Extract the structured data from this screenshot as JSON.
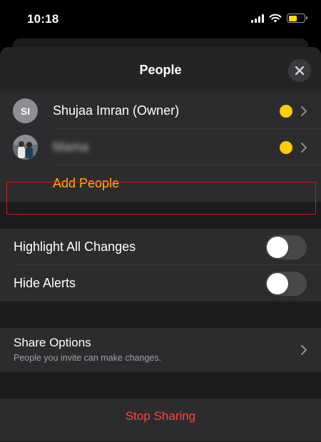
{
  "status": {
    "time": "10:18"
  },
  "sheet": {
    "title": "People"
  },
  "people": [
    {
      "initials": "SI",
      "name": "Shujaa Imran (Owner)"
    },
    {
      "initials": "",
      "name": "Mama"
    }
  ],
  "add_people_label": "Add People",
  "toggles": {
    "highlight_changes": {
      "label": "Highlight All Changes",
      "on": false
    },
    "hide_alerts": {
      "label": "Hide Alerts",
      "on": false
    }
  },
  "share_options": {
    "title": "Share Options",
    "subtitle": "People you invite can make changes."
  },
  "stop_sharing_label": "Stop Sharing",
  "colors": {
    "accent": "#ffb800",
    "status_dot": "#ffcc00",
    "destructive": "#ff453a",
    "highlight_border": "#d4161c"
  }
}
